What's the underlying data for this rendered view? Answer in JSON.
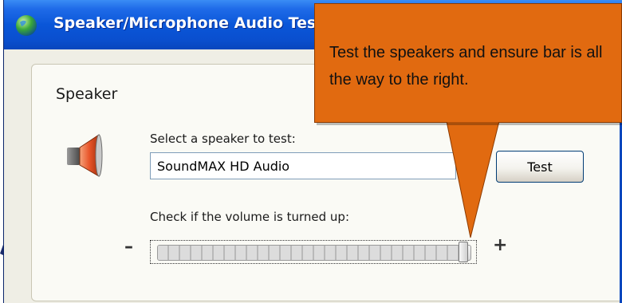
{
  "window": {
    "title": "Speaker/Microphone Audio Tes",
    "icon": "globe-icon"
  },
  "speaker_group": {
    "title": "Speaker",
    "icon": "speaker-icon",
    "select_label": "Select a speaker to test:",
    "device_value": "SoundMAX HD Audio",
    "test_button_label": "Test",
    "volume_label": "Check if the volume is turned up:",
    "minus_label": "–",
    "plus_label": "+",
    "volume_level": 0.98
  },
  "callout": {
    "text": "Test the speakers and ensure bar is all the way to the right.",
    "color": "#e16a10"
  },
  "colors": {
    "titlebar": "#0a56d8",
    "dialog_background": "#efeee5",
    "pointer_arrow": "#1a2a6a"
  }
}
